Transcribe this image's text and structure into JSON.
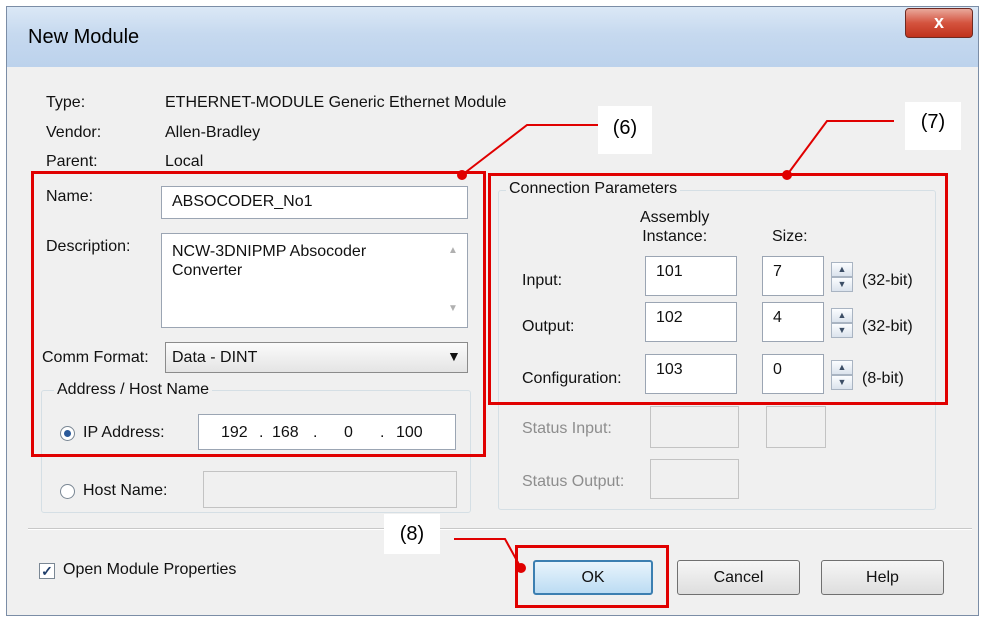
{
  "window": {
    "title": "New Module",
    "close_glyph": "x"
  },
  "info": {
    "type_label": "Type:",
    "type_value": "ETHERNET-MODULE Generic Ethernet Module",
    "vendor_label": "Vendor:",
    "vendor_value": "Allen-Bradley",
    "parent_label": "Parent:",
    "parent_value": "Local"
  },
  "form": {
    "name_label": "Name:",
    "name_value": "ABSOCODER_No1",
    "description_label": "Description:",
    "description_value": "NCW-3DNIPMP Absocoder\nConverter",
    "comm_format_label": "Comm Format:",
    "comm_format_value": "Data - DINT",
    "address_group_title": "Address / Host Name",
    "ip_label": "IP Address:",
    "ip_octets": [
      "192",
      "168",
      "0",
      "100"
    ],
    "host_label": "Host Name:",
    "host_value": ""
  },
  "connection": {
    "title": "Connection Parameters",
    "assembly_header": "Assembly\nInstance:",
    "size_header": "Size:",
    "rows": [
      {
        "label": "Input:",
        "instance": "101",
        "size": "7",
        "unit": "(32-bit)"
      },
      {
        "label": "Output:",
        "instance": "102",
        "size": "4",
        "unit": "(32-bit)"
      },
      {
        "label": "Configuration:",
        "instance": "103",
        "size": "0",
        "unit": "(8-bit)"
      }
    ],
    "status_input_label": "Status Input:",
    "status_output_label": "Status Output:"
  },
  "footer": {
    "open_props_label": "Open Module Properties",
    "open_props_checked": true,
    "ok_label": "OK",
    "cancel_label": "Cancel",
    "help_label": "Help"
  },
  "callouts": {
    "c6": "(6)",
    "c7": "(7)",
    "c8": "(8)"
  },
  "colors": {
    "annotation_red": "#e00000",
    "dialog_bg": "#f0f0f0"
  }
}
